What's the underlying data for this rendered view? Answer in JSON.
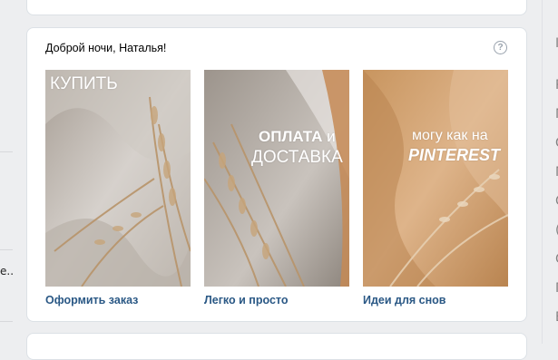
{
  "left_sidebar": {
    "truncated_text": "е..."
  },
  "right_sidebar": {
    "glyphs": [
      "І",
      "Р",
      "М",
      "G",
      "М",
      "С",
      "(",
      "О",
      "Г",
      "Е",
      "Т",
      "Ж"
    ]
  },
  "greeting": "Доброй ночи, Наталья!",
  "help_icon": "?",
  "tiles": [
    {
      "title": "КУПИТЬ",
      "caption": "Оформить заказ"
    },
    {
      "title_bold": "ОПЛАТА",
      "title_conj": " и",
      "title_line2": "ДОСТАВКА",
      "caption": "Легко и просто"
    },
    {
      "title_line1": "могу как на",
      "title_line2": "PINTEREST",
      "caption": "Идеи для снов"
    }
  ],
  "colors": {
    "background": "#edeef0",
    "link": "#2a5885",
    "card_border": "#dce1e6"
  }
}
